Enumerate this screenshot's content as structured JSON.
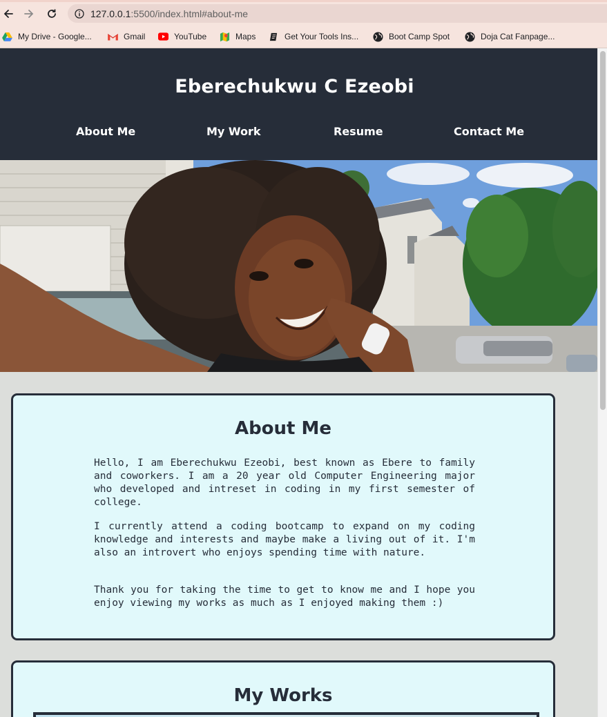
{
  "browser": {
    "url_host": "127.0.0.1",
    "url_path": ":5500/index.html#about-me",
    "bookmarks": [
      {
        "label": "My Drive - Google...",
        "icon": "google-drive-icon"
      },
      {
        "label": "Gmail",
        "icon": "gmail-icon"
      },
      {
        "label": "YouTube",
        "icon": "youtube-icon"
      },
      {
        "label": "Maps",
        "icon": "maps-icon"
      },
      {
        "label": "Get Your Tools Ins...",
        "icon": "document-icon"
      },
      {
        "label": "Boot Camp Spot",
        "icon": "globe-icon"
      },
      {
        "label": "Doja Cat Fanpage...",
        "icon": "globe-icon"
      }
    ]
  },
  "header": {
    "title": "Eberechukwu C Ezeobi",
    "nav": [
      "About Me",
      "My Work",
      "Resume",
      "Contact Me"
    ]
  },
  "about": {
    "heading": "About Me",
    "paragraphs": [
      "Hello, I am Eberechukwu Ezeobi, best known as Ebere to family and coworkers. I am a 20 year old Computer Engineering major who developed and intreset in coding in my first semester of college.",
      "I currently attend a coding bootcamp to expand on my coding knowledge and interests and maybe make a living out of it. I'm also an introvert who enjoys spending time with nature.",
      "Thank you for taking the time to get to know me and I hope you enjoy viewing my works as much as I enjoyed making them :)"
    ]
  },
  "works": {
    "heading": "My Works"
  },
  "colors": {
    "header_bg": "#262d39",
    "card_bg": "#e1f9fb",
    "page_bg": "#dcdedb",
    "chrome_bg": "#f6e4de"
  }
}
